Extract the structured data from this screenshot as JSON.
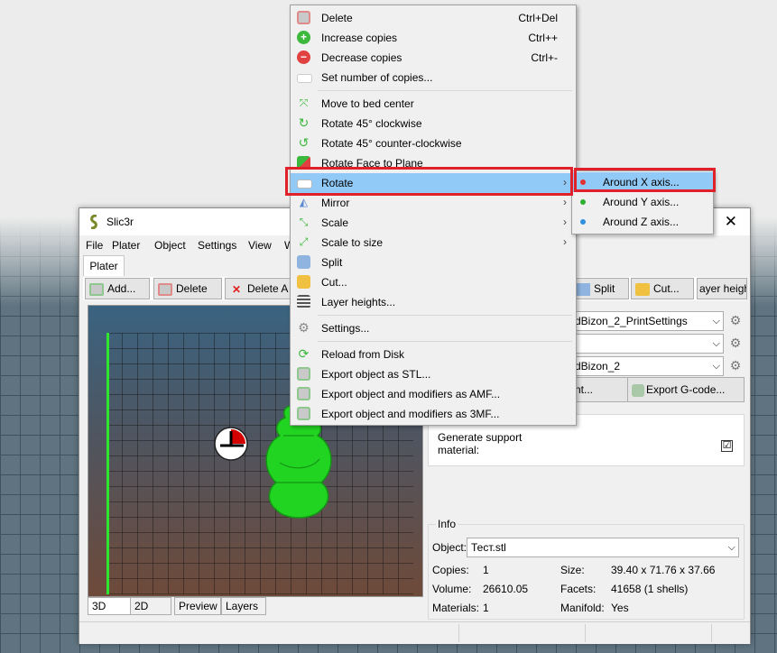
{
  "window": {
    "title": "Slic3r",
    "close_glyph": "✕",
    "menus": [
      "File",
      "Plater",
      "Object",
      "Settings",
      "View",
      "W"
    ]
  },
  "tabs": {
    "plater": "Plater"
  },
  "toolbar": {
    "add": "Add...",
    "delete": "Delete",
    "delete_all": "Delete A",
    "split": "Split",
    "cut": "Cut...",
    "layer_height": "ayer heigh"
  },
  "presets": {
    "print": "dBizon_2_PrintSettings",
    "filament": "",
    "printer": "dBizon_2"
  },
  "buttons": {
    "print": "nt...",
    "export_gcode": "Export G-code..."
  },
  "support": {
    "label": "Generate support material:",
    "checked": "☑"
  },
  "info": {
    "title": "Info",
    "object_label": "Object:",
    "object_value": "Тест.stl",
    "copies_label": "Copies:",
    "copies_value": "1",
    "size_label": "Size:",
    "size_value": "39.40 x 71.76 x 37.66",
    "volume_label": "Volume:",
    "volume_value": "26610.05",
    "facets_label": "Facets:",
    "facets_value": "41658 (1 shells)",
    "materials_label": "Materials:",
    "materials_value": "1",
    "manifold_label": "Manifold:",
    "manifold_value": "Yes"
  },
  "view_tabs": [
    "3D",
    "2D",
    "Preview",
    "Layers"
  ],
  "context_menu": {
    "items": [
      {
        "label": "Delete",
        "shortcut": "Ctrl+Del"
      },
      {
        "label": "Increase copies",
        "shortcut": "Ctrl++"
      },
      {
        "label": "Decrease copies",
        "shortcut": "Ctrl+-"
      },
      {
        "label": "Set number of copies...",
        "shortcut": ""
      },
      {
        "label": "Move to bed center",
        "shortcut": ""
      },
      {
        "label": "Rotate 45° clockwise",
        "shortcut": ""
      },
      {
        "label": "Rotate 45° counter-clockwise",
        "shortcut": ""
      },
      {
        "label": "Rotate Face to Plane",
        "shortcut": ""
      },
      {
        "label": "Rotate",
        "shortcut": ""
      },
      {
        "label": "Mirror",
        "shortcut": ""
      },
      {
        "label": "Scale",
        "shortcut": ""
      },
      {
        "label": "Scale to size",
        "shortcut": ""
      },
      {
        "label": "Split",
        "shortcut": ""
      },
      {
        "label": "Cut...",
        "shortcut": ""
      },
      {
        "label": "Layer heights...",
        "shortcut": ""
      },
      {
        "label": "Settings...",
        "shortcut": ""
      },
      {
        "label": "Reload from Disk",
        "shortcut": ""
      },
      {
        "label": "Export object as STL...",
        "shortcut": ""
      },
      {
        "label": "Export object and modifiers as AMF...",
        "shortcut": ""
      },
      {
        "label": "Export object and modifiers as 3MF...",
        "shortcut": ""
      }
    ],
    "submenu_arrow": "›"
  },
  "rotate_submenu": {
    "items": [
      {
        "label": "Around X axis...",
        "color": "#e03030"
      },
      {
        "label": "Around Y axis...",
        "color": "#30b030"
      },
      {
        "label": "Around Z axis...",
        "color": "#3090e0"
      }
    ]
  },
  "colors": {
    "highlight": "#91c9f7",
    "annotation": "#e0202a",
    "model": "#22d422"
  }
}
